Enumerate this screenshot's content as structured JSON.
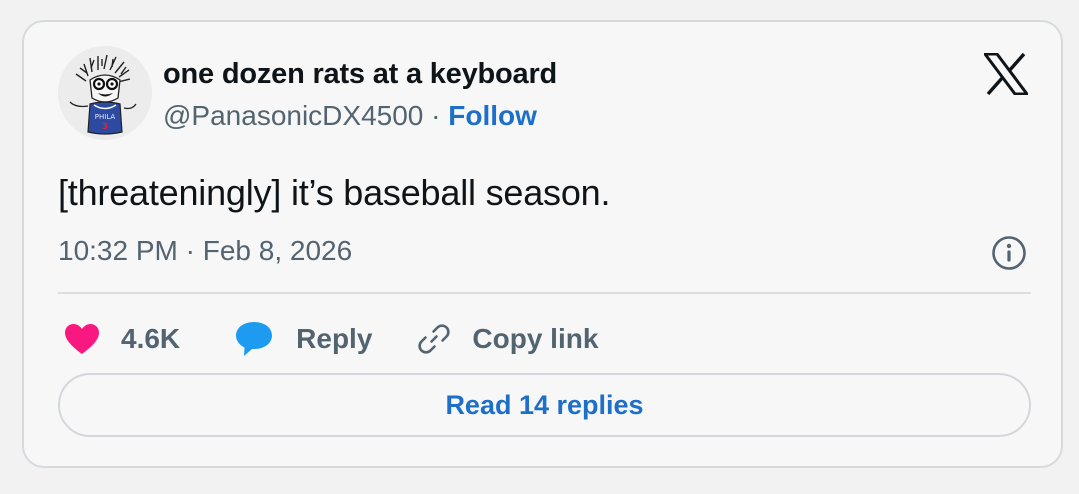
{
  "tweet": {
    "author_name": "one dozen rats at a keyboard",
    "handle": "@PanasonicDX4500",
    "separator": " · ",
    "follow_label": "Follow",
    "avatar_icon": "rat-avatar-illustration",
    "platform_icon": "x-logo-icon",
    "text": "[threateningly] it’s baseball season.",
    "timestamp": "10:32 PM · Feb 8, 2026"
  },
  "actions": {
    "like_count": "4.6K",
    "reply_label": "Reply",
    "copy_link_label": "Copy link",
    "read_replies_label": "Read 14 replies"
  },
  "colors": {
    "like": "#f91880",
    "reply": "#1d9bf0",
    "link": "#1d6fc8",
    "muted": "#536471"
  }
}
